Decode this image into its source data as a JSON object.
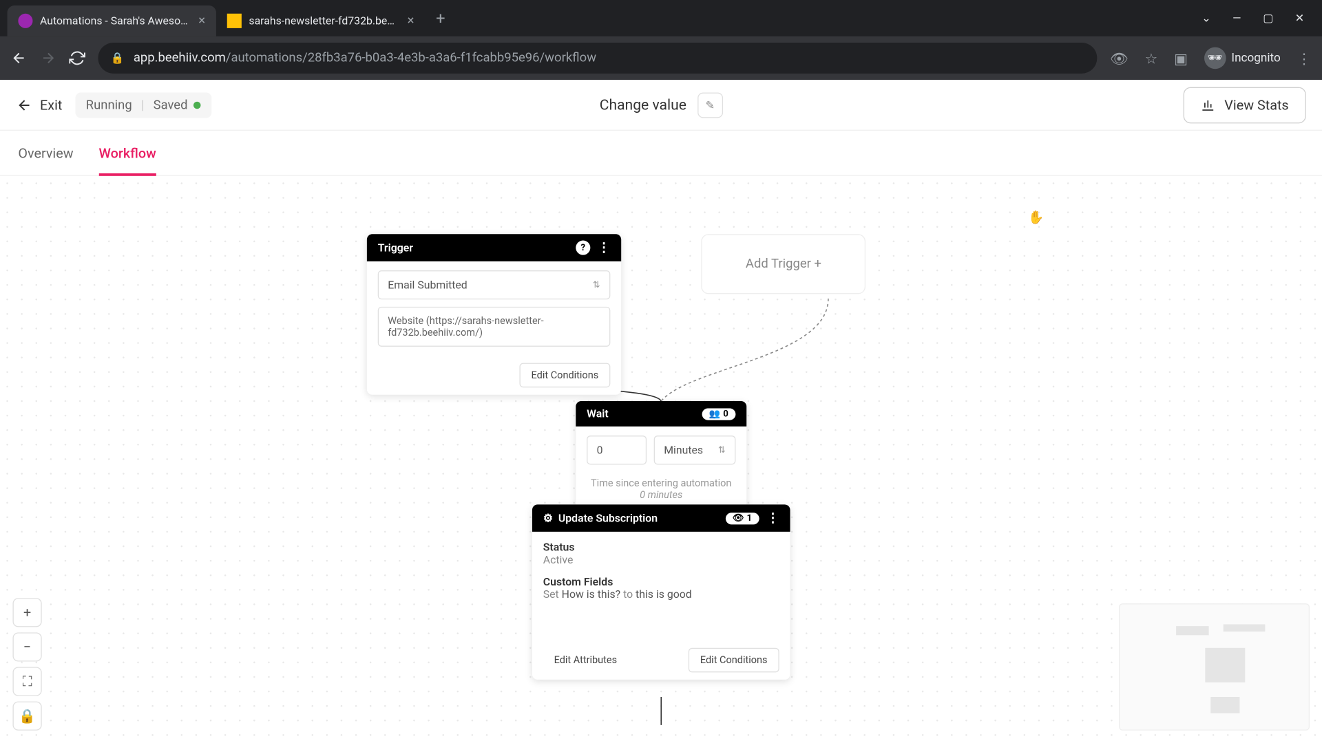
{
  "browser": {
    "tabs": [
      {
        "title": "Automations - Sarah's Awesome"
      },
      {
        "title": "sarahs-newsletter-fd732b.beehii"
      }
    ],
    "url_host": "app.beehiiv.com",
    "url_path": "/automations/28fb3a76-b0a3-4e3b-a3a6-f1fcabb95e96/workflow",
    "incognito_label": "Incognito"
  },
  "header": {
    "exit": "Exit",
    "status_running": "Running",
    "status_saved": "Saved",
    "title": "Change value",
    "view_stats": "View Stats"
  },
  "tabs": {
    "overview": "Overview",
    "workflow": "Workflow"
  },
  "trigger_node": {
    "title": "Trigger",
    "event": "Email Submitted",
    "condition": "Website (https://sarahs-newsletter-fd732b.beehiiv.com/)",
    "edit_btn": "Edit Conditions"
  },
  "add_trigger": "Add Trigger +",
  "wait_node": {
    "title": "Wait",
    "count": "0",
    "value": "0",
    "unit": "Minutes",
    "hint1": "Time since entering automation",
    "hint2": "0 minutes"
  },
  "update_node": {
    "title": "Update Subscription",
    "count": "1",
    "status_label": "Status",
    "status_value": "Active",
    "cf_label": "Custom Fields",
    "cf_prefix": "Set ",
    "cf_field": "How is this?",
    "cf_mid": " to ",
    "cf_value": "this is good",
    "edit_attrs": "Edit Attributes",
    "edit_cond": "Edit Conditions"
  }
}
